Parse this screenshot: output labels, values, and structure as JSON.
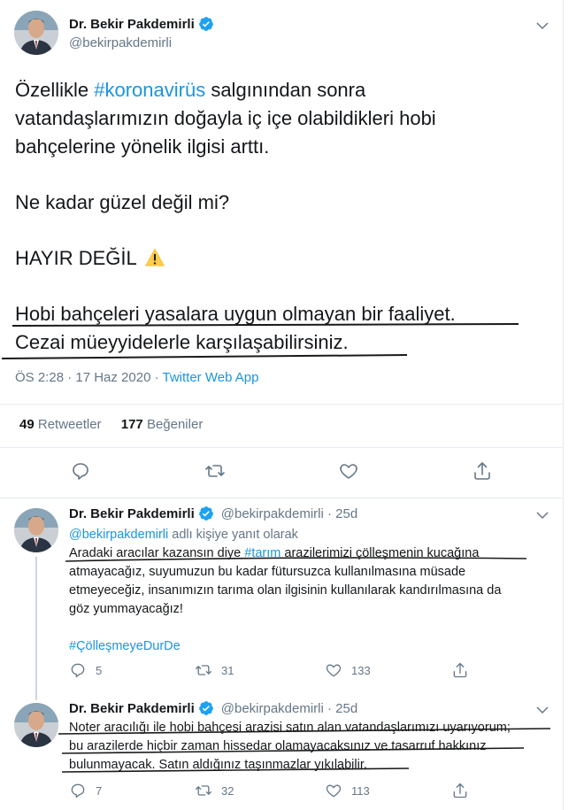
{
  "main_tweet": {
    "author_name": "Dr. Bekir Pakdemirli",
    "author_handle": "@bekirpakdemirli",
    "text": {
      "l1_pre": "Özellikle ",
      "l1_tag": "#koronavirüs",
      "l1_post": " salgınından sonra",
      "l2": "vatandaşlarımızın doğayla iç içe olabildikleri hobi",
      "l3": "bahçelerine yönelik ilgisi arttı.",
      "l4": "Ne kadar güzel değil mi?",
      "l5": "HAYIR DEĞİL",
      "l6": "Hobi bahçeleri yasalara uygun olmayan bir faaliyet.",
      "l7": "Cezai müeyyidelerle karşılaşabilirsiniz."
    },
    "time": "ÖS 2:28 · 17 Haz 2020 · ",
    "source": "Twitter Web App",
    "retweets_count": "49",
    "retweets_label": "Retweetler",
    "likes_count": "177",
    "likes_label": "Beğeniler"
  },
  "reply1": {
    "author_name": "Dr. Bekir Pakdemirli",
    "author_handle": "@bekirpakdemirli · 25d",
    "reply_to_handle": "@bekirpakdemirli",
    "reply_to_suffix": " adlı kişiye yanıt olarak",
    "l1_pre": "Aradaki aracılar kazansın diye ",
    "l1_tag": "#tarım",
    "l1_post": " arazilerimizi çölleşmenin kucağına",
    "l2": "atmayacağız, suyumuzun bu kadar fütursuzca kullanılmasına müsade",
    "l3": "etmeyeceğiz, insanımızın tarıma olan ilgisinin kullanılarak kandırılmasına da",
    "l4": "göz yummayacağız!",
    "hashtag": "#ÇölleşmeyeDurDe",
    "replies": "5",
    "retweets": "31",
    "likes": "133"
  },
  "reply2": {
    "author_name": "Dr. Bekir Pakdemirli",
    "author_handle": "@bekirpakdemirli · 25d",
    "l1": "Noter aracılığı ile hobi bahçesi arazisi satın alan vatandaşlarımızı uyarıyorum;",
    "l2": "bu arazilerde hiçbir zaman hissedar olamayacaksınız ve tasarruf hakkınız",
    "l3": "bulunmayacak. Satın aldığınız taşınmazlar yıkılabilir.",
    "replies": "7",
    "retweets": "32",
    "likes": "113"
  },
  "colors": {
    "accent": "#1b95e0",
    "muted": "#657786",
    "text": "#14171a",
    "border": "#e6ecf0",
    "warning": "#ffcc4d"
  },
  "icons": [
    "verified-badge-icon",
    "chevron-down-icon",
    "reply-icon",
    "retweet-icon",
    "like-icon",
    "share-icon",
    "warning-emoji-icon"
  ]
}
